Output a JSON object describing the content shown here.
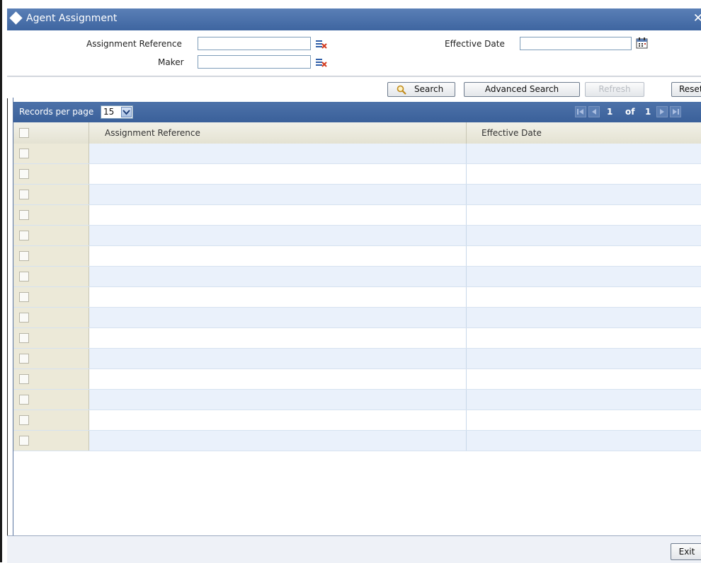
{
  "window": {
    "title": "Agent Assignment",
    "close_glyph": "✕"
  },
  "criteria": {
    "assignment_reference_label": "Assignment Reference",
    "maker_label": "Maker",
    "effective_date_label": "Effective Date",
    "assignment_reference_value": "",
    "maker_value": "",
    "effective_date_value": ""
  },
  "actions": {
    "search": "Search",
    "advanced_search": "Advanced Search",
    "refresh": "Refresh",
    "reset": "Reset"
  },
  "paging": {
    "records_per_page_label": "Records per page",
    "records_per_page_value": "15",
    "current_page": "1",
    "of_label": "of",
    "total_pages": "1"
  },
  "table": {
    "columns": [
      "Assignment Reference",
      "Effective Date"
    ],
    "row_count_visible": 15,
    "rows": []
  },
  "footer": {
    "exit": "Exit"
  },
  "colors": {
    "title_bar": "#3e65a0",
    "header_bg": "#ece9d8",
    "row_alt": "#eaf1fb"
  },
  "icons": {
    "title": "diamond-icon",
    "lov": "list-of-values-icon",
    "calendar": "calendar-icon",
    "search": "magnifier-icon"
  }
}
